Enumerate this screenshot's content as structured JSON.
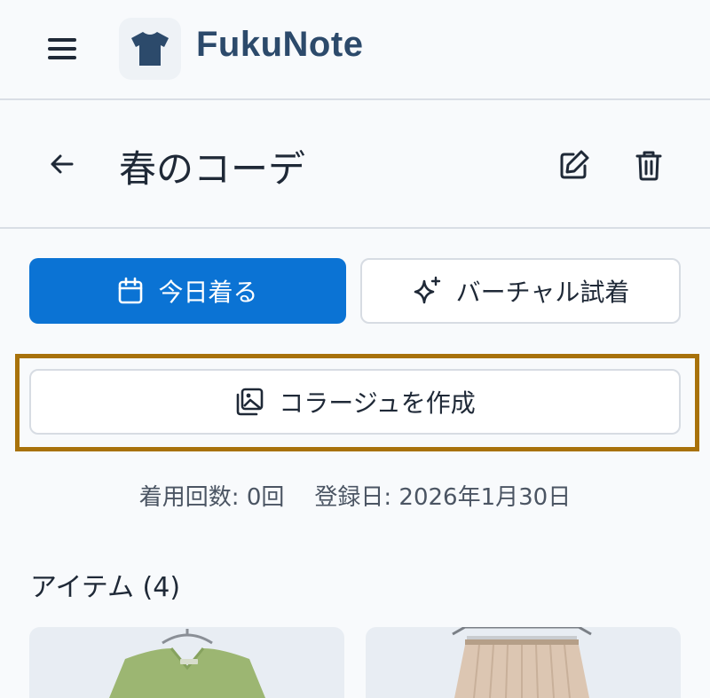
{
  "app": {
    "title": "FukuNote",
    "logo_icon": "tshirt-icon",
    "menu_icon": "menu-icon"
  },
  "page": {
    "title": "春のコーデ",
    "back_icon": "arrow-left-icon",
    "edit_icon": "edit-icon",
    "delete_icon": "trash-icon"
  },
  "actions": {
    "wear_today": {
      "label": "今日着る",
      "icon": "calendar-icon"
    },
    "virtual_tryon": {
      "label": "バーチャル試着",
      "icon": "sparkles-icon"
    },
    "create_collage": {
      "label": "コラージュを作成",
      "icon": "image-gallery-icon"
    }
  },
  "stats": {
    "wear_count": "着用回数: 0回",
    "registered": "登録日: 2026年1月30日"
  },
  "items": {
    "heading": "アイテム (4)"
  },
  "colors": {
    "brand": "#2c4a6b",
    "primary": "#0b73d4",
    "highlight": "#a8720b"
  }
}
